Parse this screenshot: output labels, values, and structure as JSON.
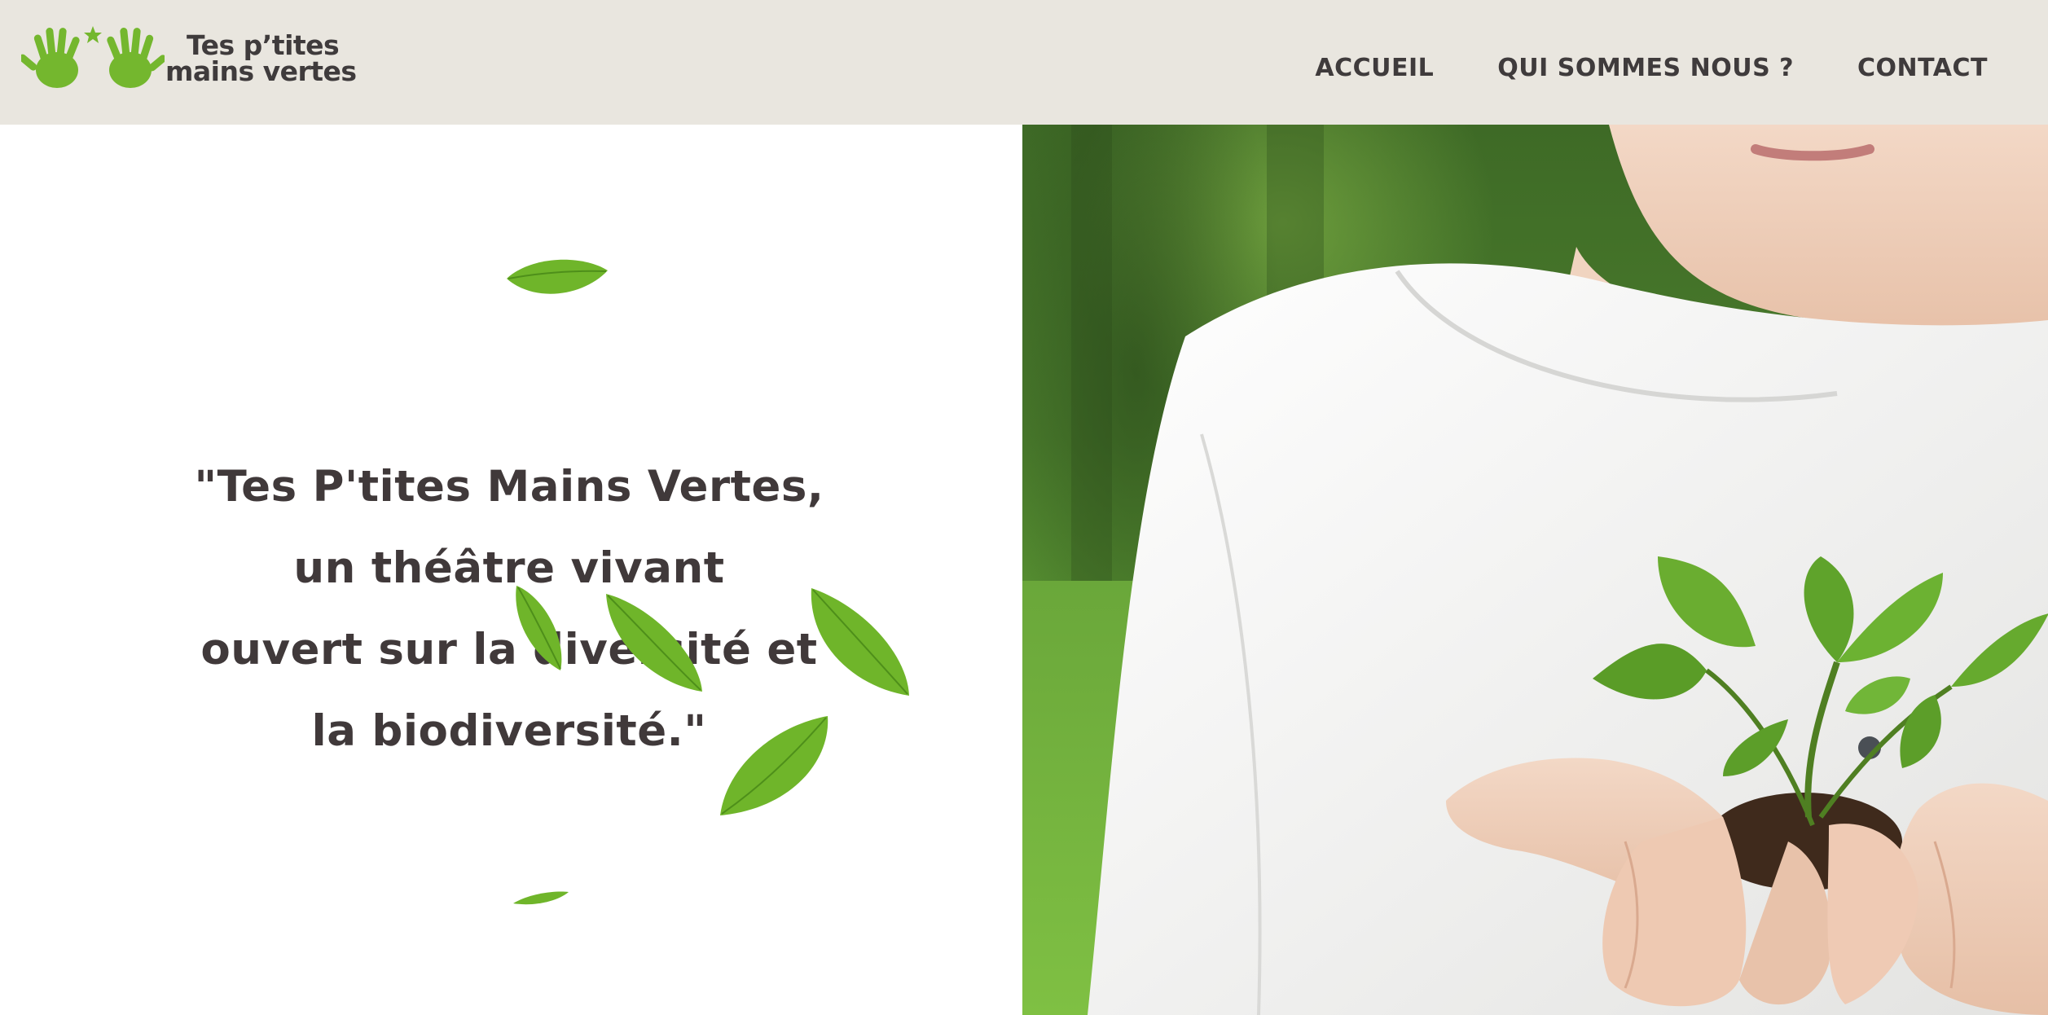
{
  "header": {
    "logo": {
      "line1": "Tes p’tites",
      "line2": "mains vertes",
      "color": "#74b72e"
    },
    "nav": [
      {
        "label": "ACCUEIL"
      },
      {
        "label": "QUI SOMMES NOUS ?"
      },
      {
        "label": "CONTACT"
      }
    ],
    "background": "#e9e6df"
  },
  "hero": {
    "quote_lines": [
      "\"Tes P'tites Mains Vertes,",
      "un théâtre vivant",
      "ouvert sur la diversité et",
      "la biodiversité.\""
    ],
    "text_color": "#40393a",
    "leaf_color": "#74b72e",
    "image_subject": "child-holding-seedling-photo"
  }
}
